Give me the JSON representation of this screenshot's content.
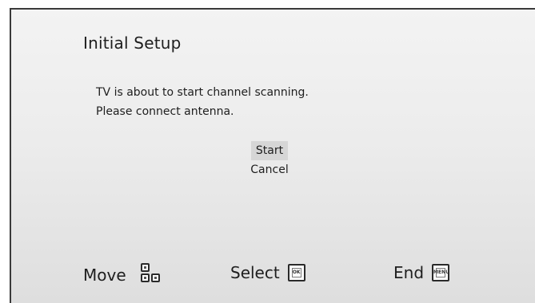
{
  "dialog": {
    "title": "Initial Setup",
    "message_line1": "TV is about to start channel scanning.",
    "message_line2": "Please connect antenna.",
    "options": [
      {
        "label": "Start",
        "selected": true
      },
      {
        "label": "Cancel",
        "selected": false
      }
    ]
  },
  "footer": {
    "move": {
      "label": "Move",
      "icon": "arrow-keys-icon"
    },
    "select": {
      "label": "Select",
      "icon": "ok-key-icon",
      "key_text": "OK"
    },
    "end": {
      "label": "End",
      "icon": "menu-key-icon",
      "key_text": "MENU"
    }
  },
  "colors": {
    "border": "#3a3a3a",
    "text": "#1e1e1e",
    "selected_bg": "#d6d6d6"
  }
}
